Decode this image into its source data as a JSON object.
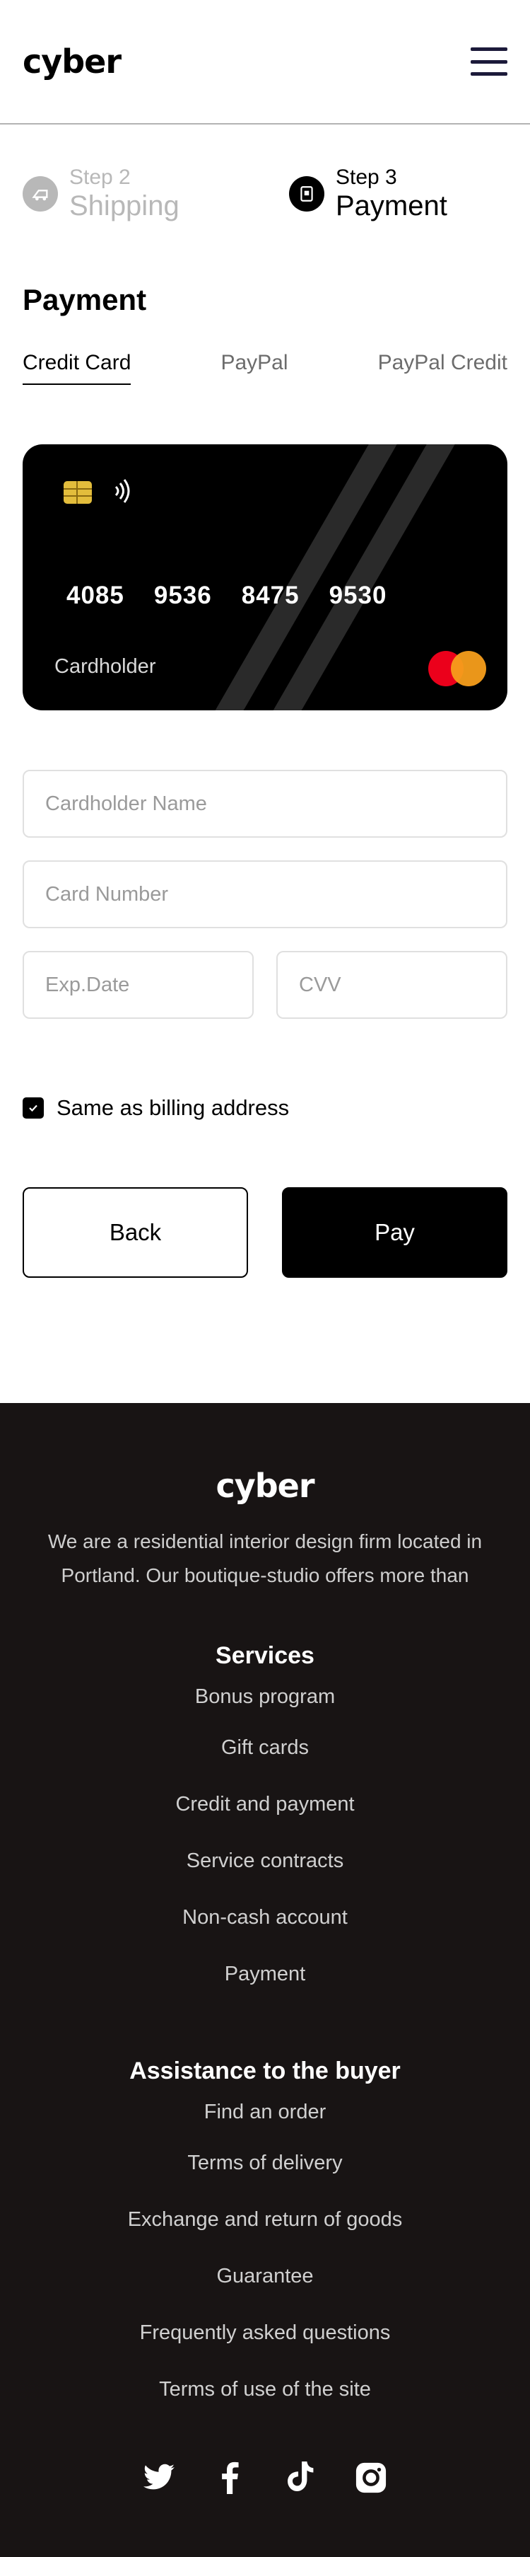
{
  "header": {
    "logo": "cyber"
  },
  "steps": [
    {
      "num": "Step 2",
      "label": "Shipping",
      "state": "inactive"
    },
    {
      "num": "Step 3",
      "label": "Payment",
      "state": "active"
    }
  ],
  "payment": {
    "title": "Payment",
    "tabs": [
      "Credit Card",
      "PayPal",
      "PayPal Credit"
    ],
    "active_tab": "Credit Card",
    "card": {
      "number_groups": [
        "4085",
        "9536",
        "8475",
        "9530"
      ],
      "holder": "Cardholder"
    },
    "fields": {
      "name_placeholder": "Cardholder Name",
      "number_placeholder": "Card Number",
      "exp_placeholder": "Exp.Date",
      "cvv_placeholder": "CVV"
    },
    "billing_checkbox": {
      "label": "Same as billing address",
      "checked": true
    },
    "back_label": "Back",
    "pay_label": "Pay"
  },
  "footer": {
    "logo": "cyber",
    "description": "We are a residential interior design firm located in Portland. Our boutique-studio offers more than",
    "services_heading": "Services",
    "services": [
      "Bonus program",
      "Gift cards",
      "Credit and payment",
      "Service contracts",
      "Non-cash account",
      "Payment"
    ],
    "assistance_heading": "Assistance to the buyer",
    "assistance": [
      "Find an order",
      "Terms of delivery",
      "Exchange and return of goods",
      "Guarantee",
      "Frequently asked questions",
      "Terms of use of the site"
    ],
    "socials": [
      "twitter-icon",
      "facebook-icon",
      "tiktok-icon",
      "instagram-icon"
    ]
  },
  "colors": {
    "accent": "#000000",
    "footer_bg": "#181414",
    "inactive": "#b8b8b8",
    "mastercard_red": "#eb001b",
    "mastercard_orange": "#f79e1b"
  }
}
